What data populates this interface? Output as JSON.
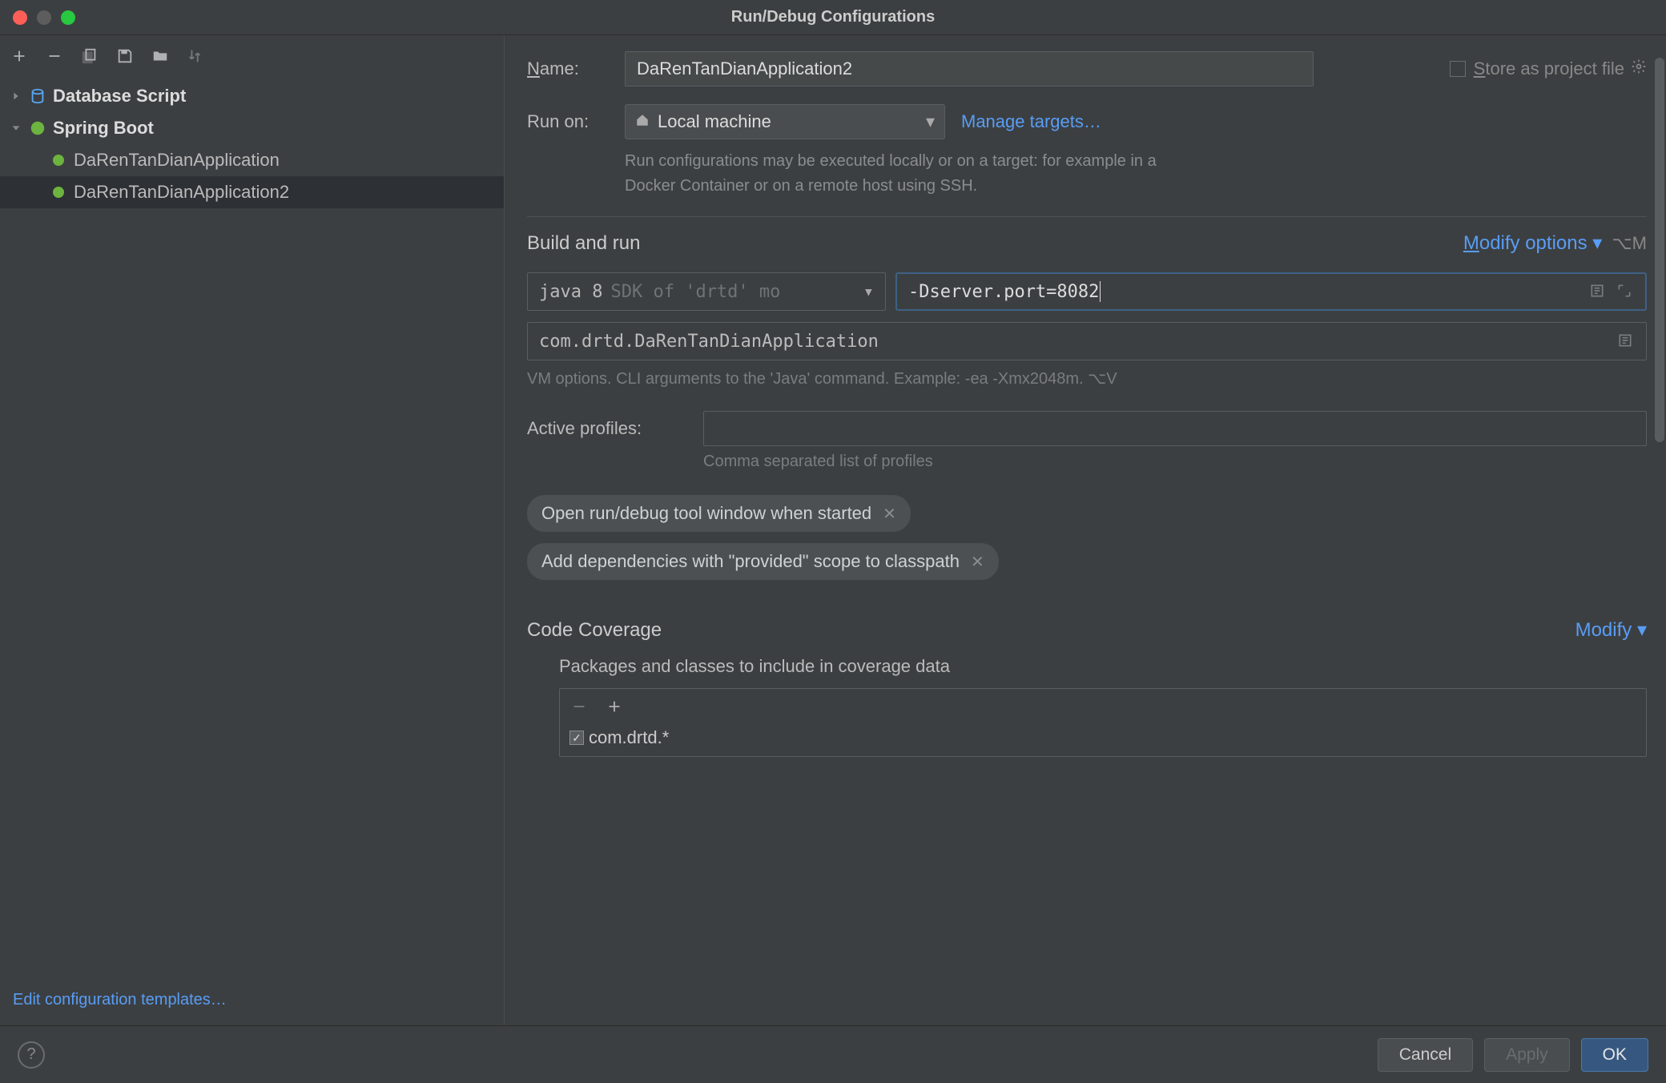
{
  "title": "Run/Debug Configurations",
  "sidebar": {
    "groups": [
      {
        "label": "Database Script",
        "expandable": true,
        "expanded": false
      },
      {
        "label": "Spring Boot",
        "expandable": true,
        "expanded": true
      }
    ],
    "items": [
      {
        "label": "DaRenTanDianApplication",
        "selected": false
      },
      {
        "label": "DaRenTanDianApplication2",
        "selected": true
      }
    ],
    "edit_templates": "Edit configuration templates…"
  },
  "form": {
    "name_label": "Name:",
    "name_value": "DaRenTanDianApplication2",
    "store_label": "Store as project file",
    "runon_label": "Run on:",
    "runon_value": "Local machine",
    "manage_targets": "Manage targets…",
    "runon_hint": "Run configurations may be executed locally or on a target: for example in a Docker Container or on a remote host using SSH.",
    "build_section": "Build and run",
    "modify_options": "Modify options",
    "modify_shortcut": "⌥M",
    "jdk_label": "java 8",
    "jdk_hint": "SDK of 'drtd' mo",
    "vm_options_value": "-Dserver.port=8082",
    "main_class": "com.drtd.DaRenTanDianApplication",
    "vm_hint": "VM options. CLI arguments to the 'Java' command. Example: -ea -Xmx2048m. ⌥V",
    "profiles_label": "Active profiles:",
    "profiles_value": "",
    "profiles_hint": "Comma separated list of profiles",
    "chips": [
      "Open run/debug tool window when started",
      "Add dependencies with \"provided\" scope to classpath"
    ],
    "coverage_section": "Code Coverage",
    "coverage_modify": "Modify",
    "coverage_sub": "Packages and classes to include in coverage data",
    "coverage_items": [
      {
        "checked": true,
        "label": "com.drtd.*"
      }
    ]
  },
  "buttons": {
    "cancel": "Cancel",
    "apply": "Apply",
    "ok": "OK"
  }
}
